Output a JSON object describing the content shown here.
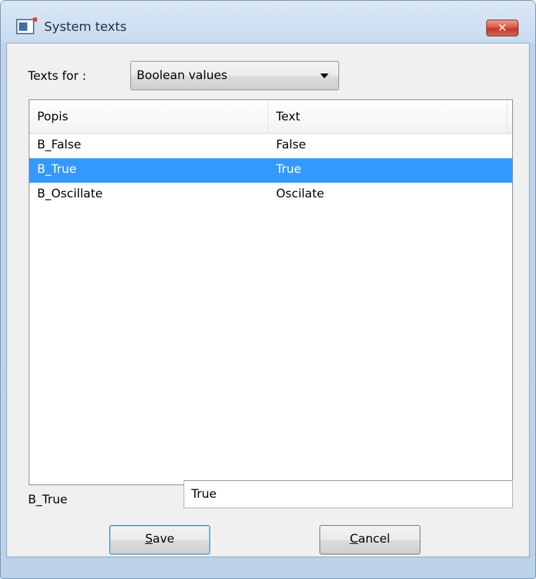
{
  "window": {
    "title": "System texts",
    "close_symbol": "✕"
  },
  "texts_for": {
    "label": "Texts for :",
    "selected": "Boolean values"
  },
  "list": {
    "columns": [
      "Popis",
      "Text"
    ],
    "rows": [
      {
        "popis": "B_False",
        "text": "False",
        "selected": false
      },
      {
        "popis": "B_True",
        "text": "True",
        "selected": true
      },
      {
        "popis": "B_Oscillate",
        "text": "Oscilate",
        "selected": false
      }
    ]
  },
  "edit": {
    "label": "B_True",
    "value": "True"
  },
  "buttons": {
    "save_mnemonic": "S",
    "save_rest": "ave",
    "cancel_mnemonic": "C",
    "cancel_rest": "ancel"
  },
  "colors": {
    "selection": "#3399ff",
    "close_button": "#c1382a"
  },
  "icons": {
    "app": "window-app-icon",
    "close": "close-icon",
    "dropdown": "chevron-down-icon"
  }
}
